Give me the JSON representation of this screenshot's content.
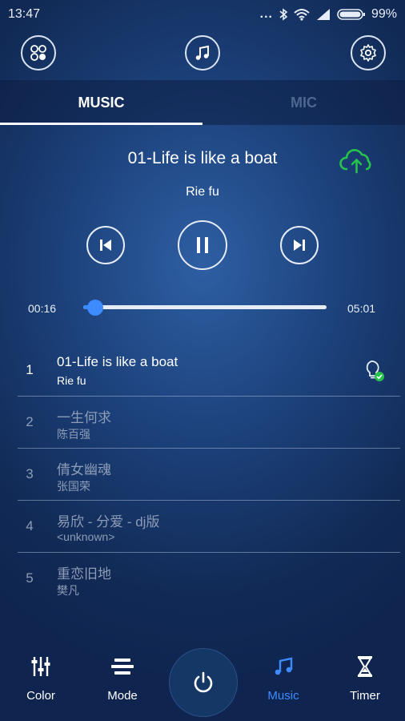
{
  "status": {
    "time": "13:47",
    "more": "...",
    "battery_pct": "99%"
  },
  "topbar": {
    "left_icon": "scene-grid-icon",
    "center_icon": "music-note-icon",
    "right_icon": "settings-gear-icon"
  },
  "tabs": [
    {
      "label": "MUSIC",
      "active": true
    },
    {
      "label": "MIC",
      "active": false
    }
  ],
  "now_playing": {
    "title": "01-Life is like a boat",
    "artist": "Rie fu",
    "elapsed": "00:16",
    "duration": "05:01",
    "progress": 0.05
  },
  "controls": {
    "prev_icon": "skip-previous-icon",
    "play_pause_icon": "pause-icon",
    "next_icon": "skip-next-icon",
    "cloud_icon": "cloud-upload-icon"
  },
  "playlist": [
    {
      "num": "1",
      "title": "01-Life is like a boat",
      "artist": "Rie fu",
      "active": true
    },
    {
      "num": "2",
      "title": "一生何求",
      "artist": "陈百强",
      "active": false
    },
    {
      "num": "3",
      "title": "倩女幽魂",
      "artist": "张国荣",
      "active": false
    },
    {
      "num": "4",
      "title": "易欣 - 分爱 - dj版",
      "artist": "<unknown>",
      "active": false
    },
    {
      "num": "5",
      "title": "重恋旧地",
      "artist": "樊凡",
      "active": false
    }
  ],
  "nav": {
    "color": "Color",
    "mode": "Mode",
    "music": "Music",
    "timer": "Timer",
    "active": "music"
  },
  "colors": {
    "accent": "#3d8bff",
    "cloud_green": "#27c24c",
    "bg_dark": "#0f2550"
  }
}
